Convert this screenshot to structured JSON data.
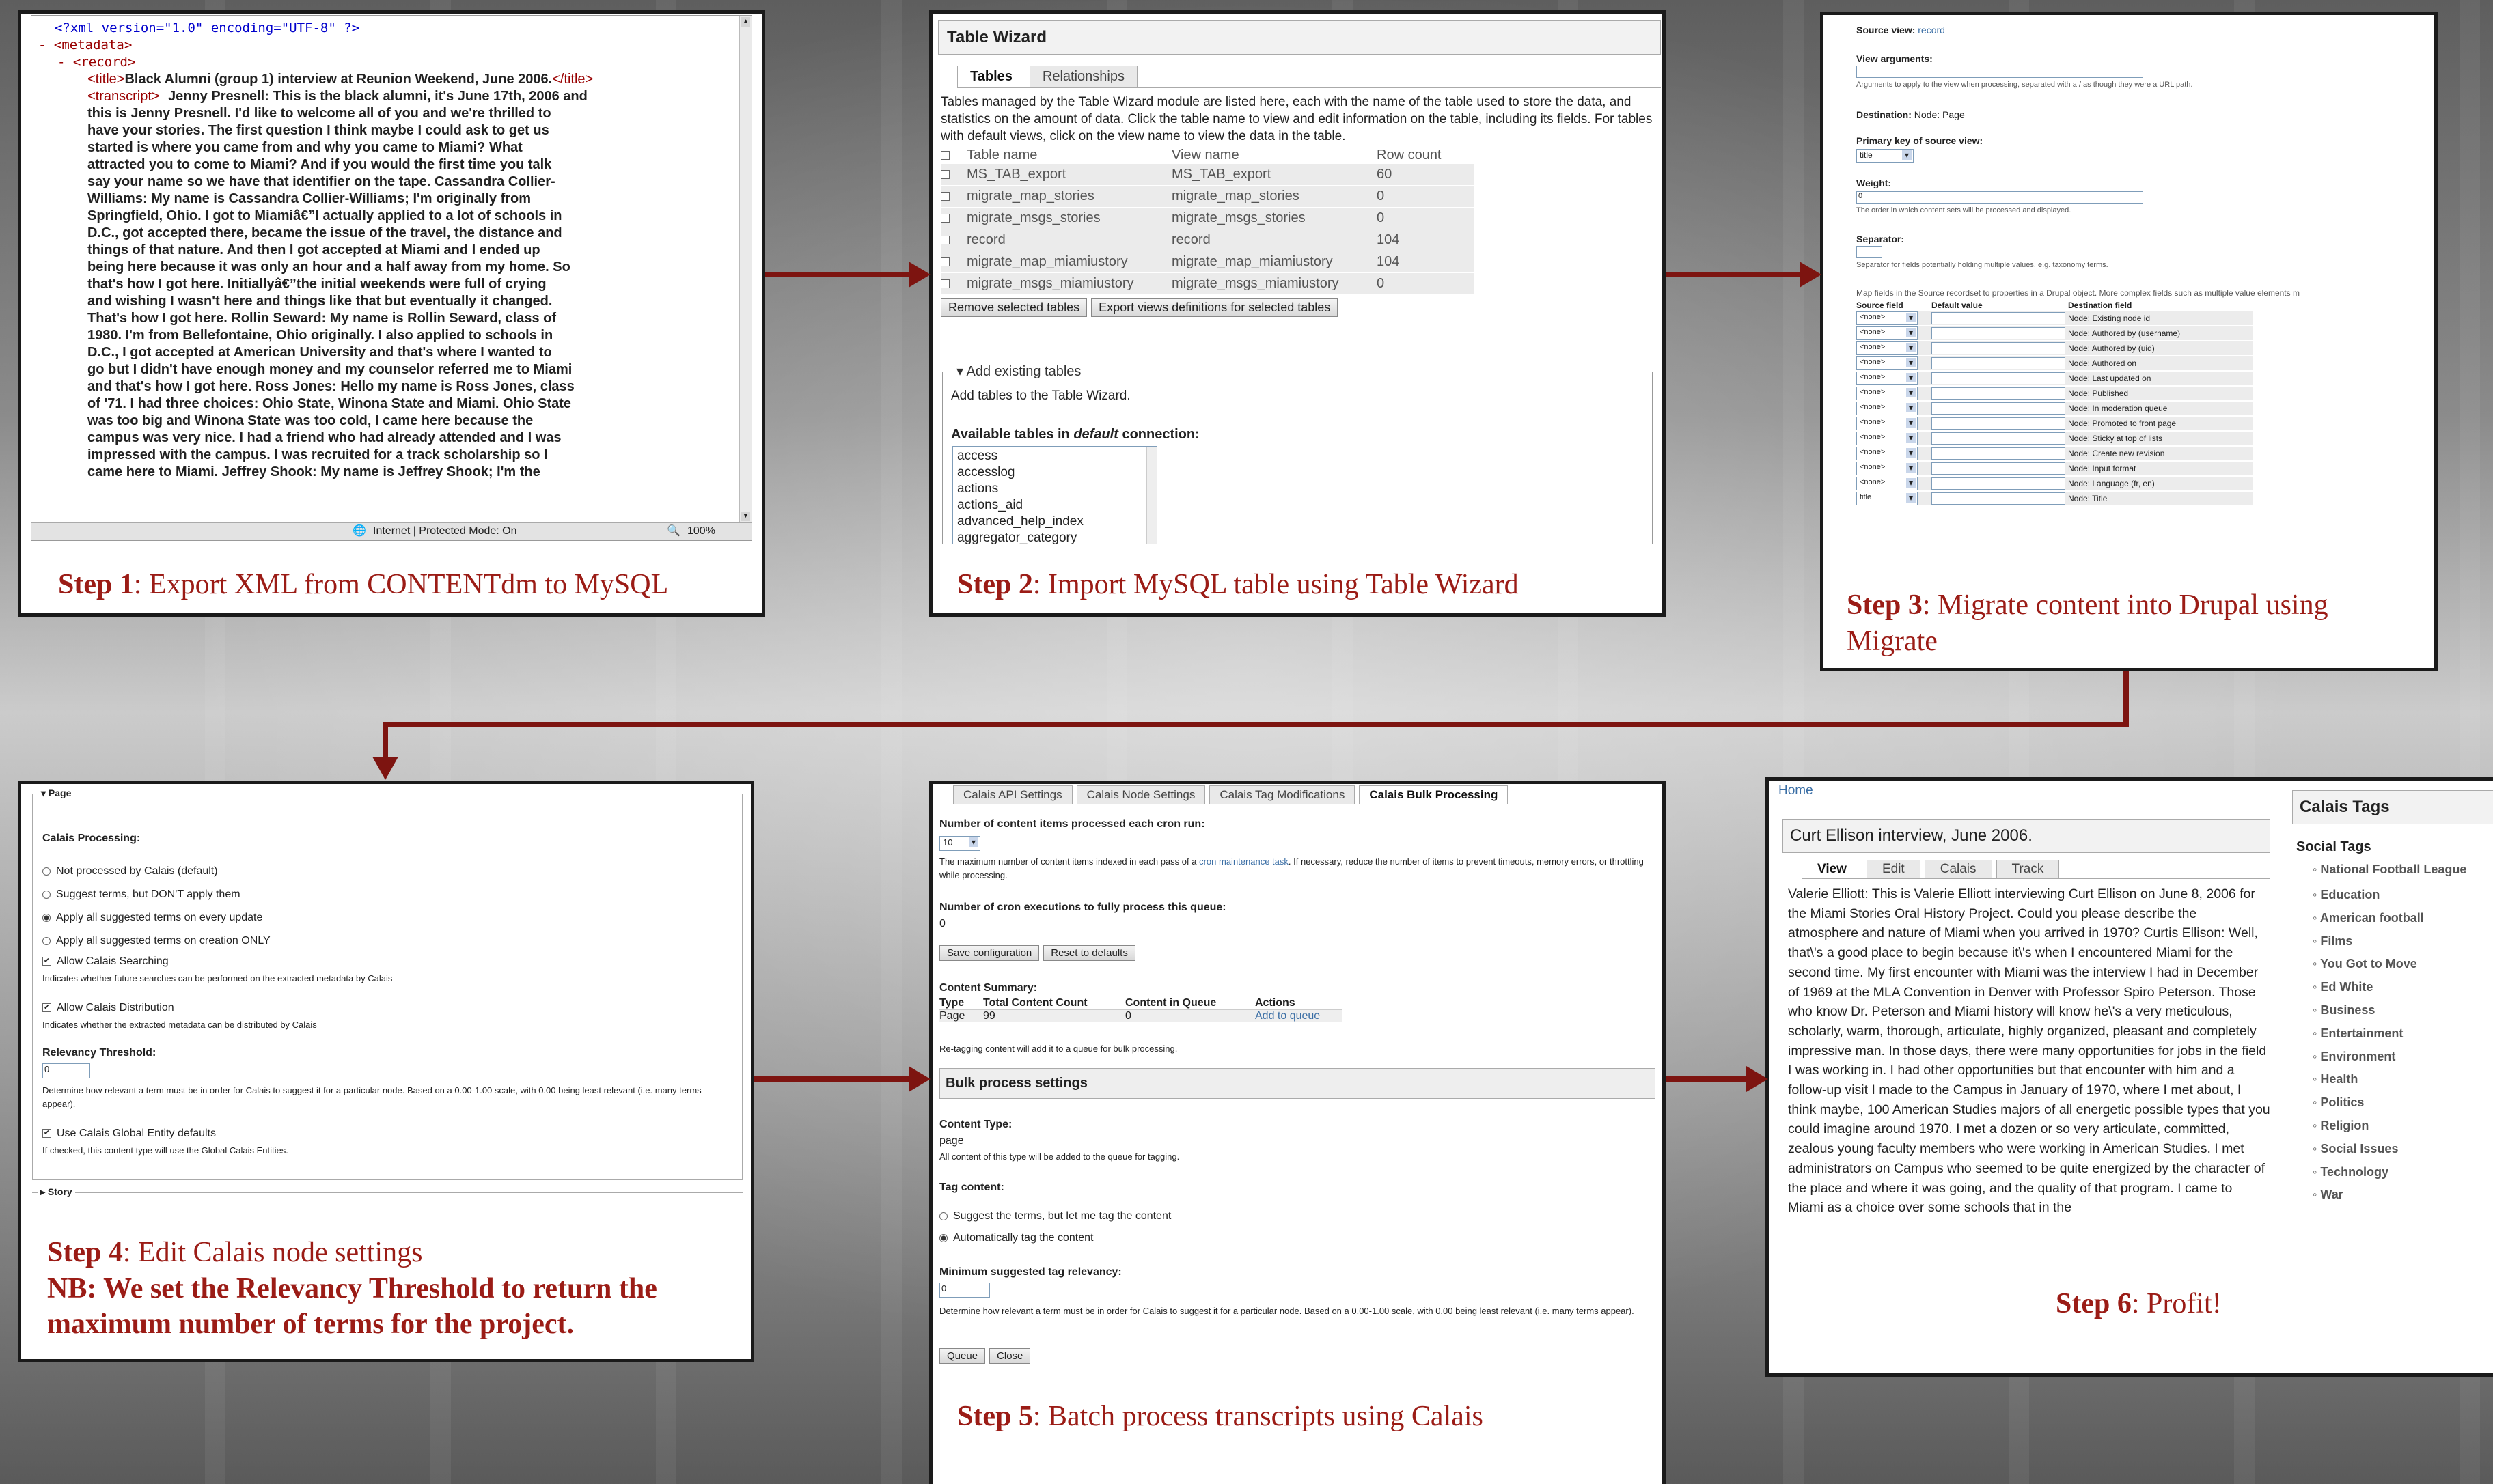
{
  "step1": {
    "caption_bold": "Step 1",
    "caption_rest": ": Export XML from CONTENTdm to MySQL",
    "xml_decl": "<?xml version=\"1.0\" encoding=\"UTF-8\" ?>",
    "metadata_open": "- <metadata>",
    "record_open": "- <record>",
    "title_open": "<title>",
    "title_text": "Black Alumni (group 1) interview at Reunion Weekend, June 2006.",
    "title_close": "</title>",
    "transcript_open": "<transcript>",
    "transcript_lines": [
      "Jenny Presnell: This is the black alumni, it's June 17th, 2006 and",
      "this is Jenny Presnell. I'd like to welcome all of you and we're thrilled to",
      "have your stories. The first question I think maybe I could ask to get us",
      "started is where you came from and why you came to Miami? What",
      "attracted you to come to Miami? And if you would the first time you talk",
      "say your name so we have that identifier on the tape. Cassandra Collier-",
      "Williams: My name is Cassandra Collier-Williams; I'm originally from",
      "Springfield, Ohio. I got to Miamiâ€”I actually applied to a lot of schools in",
      "D.C., got accepted there, became the issue of the travel, the distance and",
      "things of that nature. And then I got accepted at Miami and I ended up",
      "being here because it was only an hour and a half away from my home. So",
      "that's how I got here. Initiallyâ€”the initial weekends were full of crying",
      "and wishing I wasn't here and things like that but eventually it changed.",
      "That's how I got here. Rollin Seward: My name is Rollin Seward, class of",
      "1980. I'm from Bellefontaine, Ohio originally. I also applied to schools in",
      "D.C., I got accepted at American University and that's where I wanted to",
      "go but I didn't have enough money and my counselor referred me to Miami",
      "and that's how I got here. Ross Jones: Hello my name is Ross Jones, class",
      "of '71. I had three choices: Ohio State, Winona State and Miami. Ohio State",
      "was too big and Winona State was too cold, I came here because the",
      "campus was very nice. I had a friend who had already attended and I was",
      "impressed with the campus. I was recruited for a track scholarship so I",
      "came here to Miami. Jeffrey Shook: My name is Jeffrey Shook; I'm the"
    ],
    "status_zone": "Internet | Protected Mode: On",
    "status_zoom": "100%"
  },
  "step2": {
    "caption_bold": "Step 2",
    "caption_rest": ": Import MySQL table using Table Wizard",
    "title": "Table Wizard",
    "tabs": [
      "Tables",
      "Relationships"
    ],
    "description": "Tables managed by the Table Wizard module are listed here, each with the name of the table used to store the data, and statistics on the amount of data. Click the table name to view and edit information on the table, including its fields. For tables with default views, click on the view name to view the data in the table.",
    "columns": [
      "Table name",
      "View name",
      "Row count"
    ],
    "rows": [
      [
        "MS_TAB_export",
        "MS_TAB_export",
        "60"
      ],
      [
        "migrate_map_stories",
        "migrate_map_stories",
        "0"
      ],
      [
        "migrate_msgs_stories",
        "migrate_msgs_stories",
        "0"
      ],
      [
        "record",
        "record",
        "104"
      ],
      [
        "migrate_map_miamiustory",
        "migrate_map_miamiustory",
        "104"
      ],
      [
        "migrate_msgs_miamiustory",
        "migrate_msgs_miamiustory",
        "0"
      ]
    ],
    "buttons": [
      "Remove selected tables",
      "Export views definitions for selected tables"
    ],
    "fieldset": "Add existing tables",
    "add_help": "Add tables to the Table Wizard.",
    "available_pre": "Available tables in ",
    "available_em": "default",
    "available_post": " connection:",
    "available_list": [
      "access",
      "accesslog",
      "actions",
      "actions_aid",
      "advanced_help_index",
      "aggregator_category"
    ]
  },
  "step3": {
    "caption_bold": "Step 3",
    "caption_rest": ": Migrate content into Drupal using Migrate",
    "source_view_label": "Source view:",
    "source_view_value": "record",
    "view_args_label": "View arguments:",
    "view_args_help": "Arguments to apply to the view when processing, separated with a / as though they were a URL path.",
    "destination_label": "Destination:",
    "destination_value": "Node: Page",
    "pk_label": "Primary key of source view:",
    "pk_value": "title",
    "weight_label": "Weight:",
    "weight_value": "0",
    "weight_help": "The order in which content sets will be processed and displayed.",
    "separator_label": "Separator:",
    "separator_help": "Separator for fields potentially holding multiple values, e.g. taxonomy terms.",
    "map_help": "Map fields in the Source recordset to properties in a Drupal object. More complex fields such as multiple value elements m",
    "map_cols": [
      "Source field",
      "Default value",
      "Destination field"
    ],
    "map_rows": [
      [
        "<none>",
        "Node: Existing node id"
      ],
      [
        "<none>",
        "Node: Authored by (username)"
      ],
      [
        "<none>",
        "Node: Authored by (uid)"
      ],
      [
        "<none>",
        "Node: Authored on"
      ],
      [
        "<none>",
        "Node: Last updated on"
      ],
      [
        "<none>",
        "Node: Published"
      ],
      [
        "<none>",
        "Node: In moderation queue"
      ],
      [
        "<none>",
        "Node: Promoted to front page"
      ],
      [
        "<none>",
        "Node: Sticky at top of lists"
      ],
      [
        "<none>",
        "Node: Create new revision"
      ],
      [
        "<none>",
        "Node: Input format"
      ],
      [
        "<none>",
        "Node: Language (fr, en)"
      ],
      [
        "title",
        "Node: Title"
      ]
    ]
  },
  "step4": {
    "caption_bold": "Step 4",
    "caption_rest": ": Edit Calais node settings",
    "caption_nb": "NB: We set the Relevancy Threshold to return the maximum number of terms  for the project.",
    "page_legend": "Page",
    "processing_label": "Calais Processing:",
    "radios": [
      "Not processed by Calais (default)",
      "Suggest terms, but DON'T apply them",
      "Apply all suggested terms on every update",
      "Apply all suggested terms on creation ONLY"
    ],
    "allow_search": "Allow Calais Searching",
    "allow_search_help": "Indicates whether future searches can be performed on the extracted metadata by Calais",
    "allow_dist": "Allow Calais Distribution",
    "allow_dist_help": "Indicates whether the extracted metadata can be distributed by Calais",
    "relevancy_label": "Relevancy Threshold:",
    "relevancy_value": "0",
    "relevancy_help": "Determine how relevant a term must be in order for Calais to suggest it for a particular node. Based on a 0.00-1.00 scale, with 0.00 being least relevant (i.e. many terms appear).",
    "global_label": "Use Calais Global Entity defaults",
    "global_help": "If checked, this content type will use the Global Calais Entities.",
    "story_legend": "Story"
  },
  "step5": {
    "caption_bold": "Step 5",
    "caption_rest": ": Batch process transcripts using  Calais",
    "tabs": [
      "Calais API Settings",
      "Calais Node Settings",
      "Calais Tag Modifications",
      "Calais Bulk Processing"
    ],
    "items_label": "Number of content items processed each cron run:",
    "items_value": "10",
    "items_help_pre": "The maximum number of content items indexed in each pass of a ",
    "items_help_link": "cron maintenance task",
    "items_help_post": ". If necessary, reduce the number of items to prevent timeouts, memory errors, or throttling while processing.",
    "cron_label": "Number of cron executions to fully process this queue:",
    "cron_value": "0",
    "buttons1": [
      "Save configuration",
      "Reset to defaults"
    ],
    "summary_label": "Content Summary:",
    "summary_cols": [
      "Type",
      "Total Content Count",
      "Content in Queue",
      "Actions"
    ],
    "summary_row": [
      "Page",
      "99",
      "0",
      "Add to queue"
    ],
    "retag_help": "Re-tagging content will add it to a queue for bulk processing.",
    "bulk_header": "Bulk process settings",
    "ctype_label": "Content Type:",
    "ctype_value": "page",
    "ctype_help": "All content of this type will be added to the queue for tagging.",
    "tag_label": "Tag content:",
    "tag_radios": [
      "Suggest the terms, but let me tag the content",
      "Automatically tag the content"
    ],
    "min_label": "Minimum suggested tag relevancy:",
    "min_value": "0",
    "min_help": "Determine how relevant a term must be in order for Calais to suggest it for a particular node. Based on a 0.00-1.00 scale, with 0.00 being least relevant (i.e. many terms appear).",
    "buttons2": [
      "Queue",
      "Close"
    ]
  },
  "step6": {
    "caption_bold": "Step 6",
    "caption_rest": ": Profit!",
    "home": "Home",
    "node_title": "Curt Ellison interview, June 2006.",
    "tabs": [
      "View",
      "Edit",
      "Calais",
      "Track"
    ],
    "body": "Valerie Elliott: This is Valerie Elliott interviewing Curt Ellison on June 8, 2006 for the Miami Stories Oral History Project. Could you please describe the atmosphere and nature of Miami when you arrived in 1970? Curtis Ellison: Well, that\\'s a good place to begin because it\\'s when I encountered Miami for the second time. My first encounter with Miami was the interview I had in December of 1969 at the MLA Convention in Denver with Professor Spiro Peterson. Those who know Dr. Peterson and Miami history will know he\\'s a very meticulous, scholarly, warm, thorough, articulate, highly organized, pleasant and completely impressive man. In those days, there were many opportunities for jobs in the field I was working in. I had other opportunities but that encounter with him and a follow-up visit I made to the Campus in January of 1970, where I met about, I think maybe, 100 American Studies majors of all energetic possible types that you could imagine around 1970. I met a dozen or so very articulate, committed, zealous young faculty members who were working in American Studies. I met administrators on Campus who seemed to be quite energized by the character of the place and where it was going, and the quality of that program. I came to Miami as a choice over some schools that in the",
    "tags_title": "Calais Tags",
    "social_label": "Social Tags",
    "tags": [
      "National Football League",
      "Education",
      "American football",
      "Films",
      "You Got to Move",
      "Ed White",
      "Business",
      "Entertainment",
      "Environment",
      "Health",
      "Politics",
      "Religion",
      "Social Issues",
      "Technology",
      "War"
    ]
  },
  "colors": {
    "caption": "#9b1c16",
    "arrow": "#7d1410",
    "xml_tag": "#990000",
    "xml_text": "#000000"
  }
}
